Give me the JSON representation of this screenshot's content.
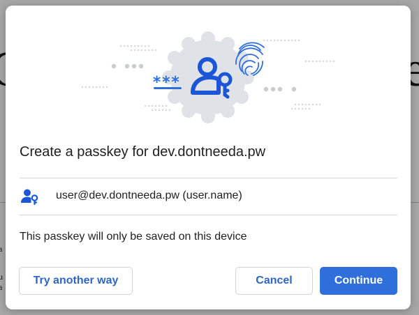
{
  "dialog": {
    "title": "Create a passkey for dev.dontneeda.pw",
    "account": {
      "label": "user@dev.dontneeda.pw (user.name)",
      "icon": "passkey-user-icon"
    },
    "info": "This passkey will only be saved on this device",
    "buttons": {
      "try_another_way": "Try another way",
      "cancel": "Cancel",
      "continue": "Continue"
    },
    "illustration": {
      "password_mask": "***",
      "icons": [
        "passkey-user-icon",
        "fingerprint-icon"
      ]
    }
  },
  "colors": {
    "accent": "#2e6fdc",
    "accent_text": "#2f66c4",
    "icon_blue": "#1a56d6",
    "badge_gray": "#dfe2e7"
  }
}
